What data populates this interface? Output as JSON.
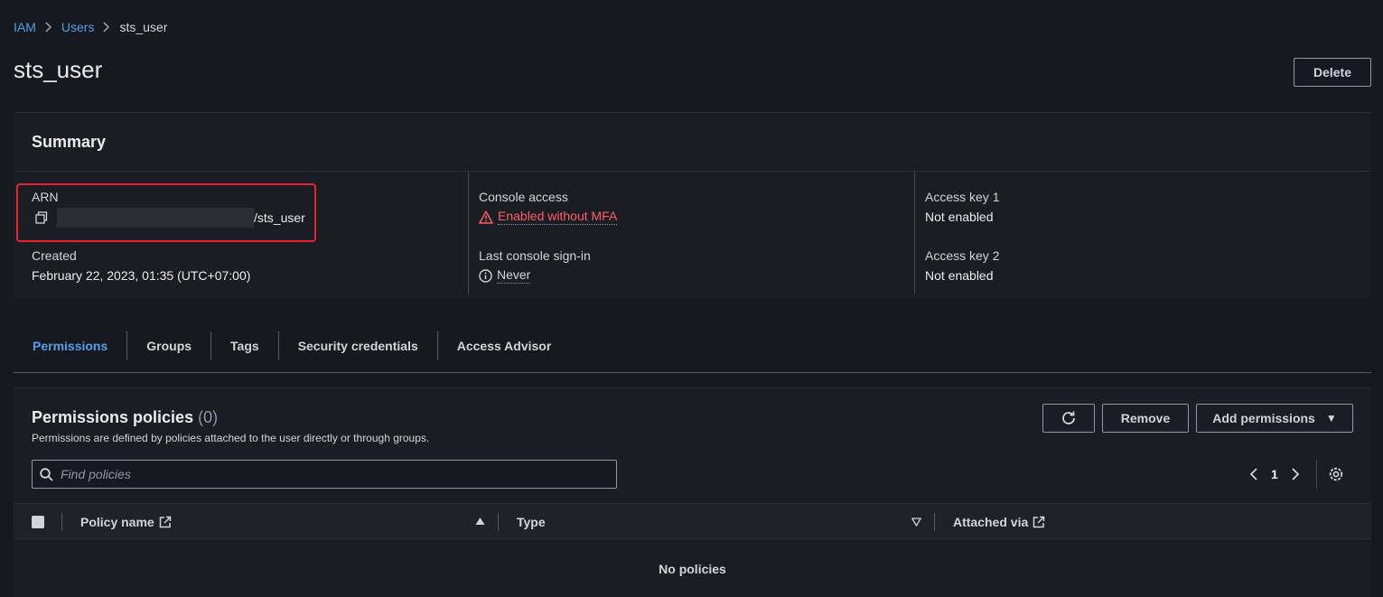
{
  "breadcrumb": {
    "items": [
      "IAM",
      "Users"
    ],
    "current": "sts_user"
  },
  "page": {
    "title": "sts_user",
    "delete_label": "Delete"
  },
  "summary": {
    "heading": "Summary",
    "arn_label": "ARN",
    "arn_value_suffix": "/sts_user",
    "created_label": "Created",
    "created_value": "February 22, 2023, 01:35 (UTC+07:00)",
    "console_access_label": "Console access",
    "console_access_value": "Enabled without MFA",
    "last_signin_label": "Last console sign-in",
    "last_signin_value": "Never",
    "access_key1_label": "Access key 1",
    "access_key1_value": "Not enabled",
    "access_key2_label": "Access key 2",
    "access_key2_value": "Not enabled"
  },
  "tabs": [
    {
      "label": "Permissions",
      "active": true
    },
    {
      "label": "Groups"
    },
    {
      "label": "Tags"
    },
    {
      "label": "Security credentials"
    },
    {
      "label": "Access Advisor"
    }
  ],
  "permissions": {
    "title": "Permissions policies",
    "count": "(0)",
    "description": "Permissions are defined by policies attached to the user directly or through groups.",
    "remove_label": "Remove",
    "add_label": "Add permissions",
    "search_placeholder": "Find policies",
    "page_number": "1",
    "columns": {
      "policy_name": "Policy name",
      "type": "Type",
      "attached_via": "Attached via"
    },
    "empty_text": "No policies"
  },
  "colors": {
    "accent": "#539fe5",
    "warning": "#ff5d64",
    "highlight": "#e8212d"
  }
}
